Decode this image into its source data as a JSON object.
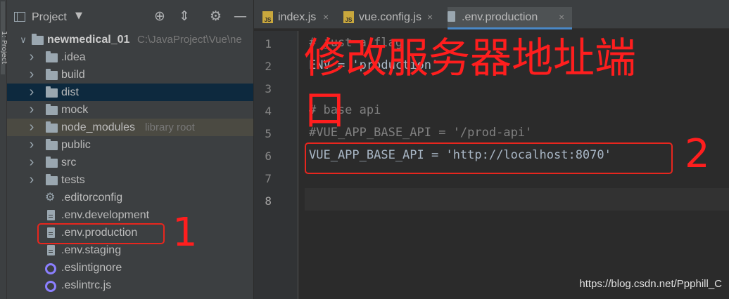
{
  "strip": {
    "label": "1: Project"
  },
  "panel": {
    "title": "Project",
    "tree": [
      {
        "label": "newmedical_01",
        "extra": "C:\\JavaProject\\Vue\\ne",
        "kind": "root"
      },
      {
        "label": ".idea",
        "kind": "folder"
      },
      {
        "label": "build",
        "kind": "folder"
      },
      {
        "label": "dist",
        "kind": "folder"
      },
      {
        "label": "mock",
        "kind": "folder"
      },
      {
        "label": "node_modules",
        "extra": "library root",
        "kind": "folder"
      },
      {
        "label": "public",
        "kind": "folder"
      },
      {
        "label": "src",
        "kind": "folder"
      },
      {
        "label": "tests",
        "kind": "folder"
      },
      {
        "label": ".editorconfig",
        "kind": "gear"
      },
      {
        "label": ".env.development",
        "kind": "file"
      },
      {
        "label": ".env.production",
        "kind": "file"
      },
      {
        "label": ".env.staging",
        "kind": "file"
      },
      {
        "label": ".eslintignore",
        "kind": "ring"
      },
      {
        "label": ".eslintrc.js",
        "kind": "ring"
      }
    ]
  },
  "tabs": [
    {
      "label": "index.js",
      "icon": "js-file-icon"
    },
    {
      "label": "vue.config.js",
      "icon": "js-file-icon"
    },
    {
      "label": ".env.production",
      "icon": "env-file-icon",
      "active": true
    }
  ],
  "editor": {
    "line_numbers": [
      "1",
      "2",
      "3",
      "4",
      "5",
      "6",
      "7",
      "8"
    ],
    "lines": [
      "# just a flag",
      "ENV = 'production'",
      "",
      "# base api",
      "#VUE_APP_BASE_API = '/prod-api'",
      "VUE_APP_BASE_API = 'http://localhost:8070'",
      "",
      ""
    ]
  },
  "annotations": {
    "heading": "修改服务器地址端",
    "heading_cont": "口",
    "num1": "1",
    "num2": "2"
  },
  "watermark": "https://blog.csdn.net/Ppphill_C",
  "colors": {
    "annotation": "#ff1e1e",
    "accent": "#4a88c7",
    "selected_row": "#0d293e"
  }
}
